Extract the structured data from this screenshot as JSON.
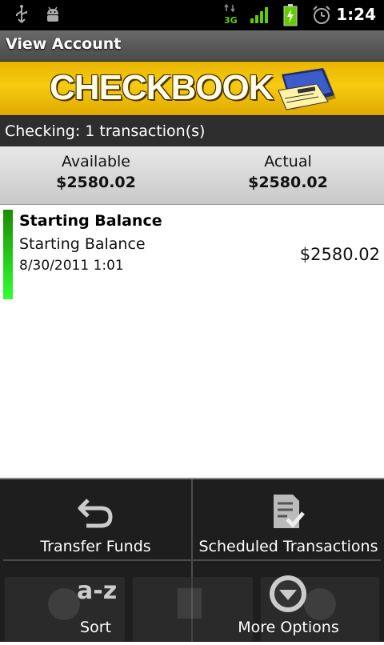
{
  "status_bar": {
    "time": "1:24",
    "network": "3G",
    "icons": [
      "usb-icon",
      "android-debug-icon",
      "3g-data-icon",
      "signal-icon",
      "battery-charging-icon",
      "alarm-icon"
    ]
  },
  "title_bar": {
    "title": "View Account"
  },
  "banner": {
    "title": "CHECKBOOK",
    "logo_label": "CHECKBOOK"
  },
  "account": {
    "summary": "Checking: 1 transaction(s)"
  },
  "balances": {
    "available_label": "Available",
    "available_value": "$2580.02",
    "actual_label": "Actual",
    "actual_value": "$2580.02"
  },
  "transactions": [
    {
      "title": "Starting Balance",
      "description": "Starting Balance",
      "date": "8/30/2011 1:01",
      "amount": "$2580.02",
      "indicator_color": "#22c400"
    }
  ],
  "menu": {
    "items": [
      {
        "label": "Transfer Funds",
        "icon": "undo-arrow-icon"
      },
      {
        "label": "Scheduled Transactions",
        "icon": "checklist-icon"
      },
      {
        "label": "Sort",
        "icon": "a-z-sort-icon"
      },
      {
        "label": "More Options",
        "icon": "more-options-icon"
      }
    ]
  },
  "colors": {
    "banner_yellow": "#f6cb10",
    "title_bar": "#5a5a5a",
    "menu_bg": "#1e1e1e"
  }
}
